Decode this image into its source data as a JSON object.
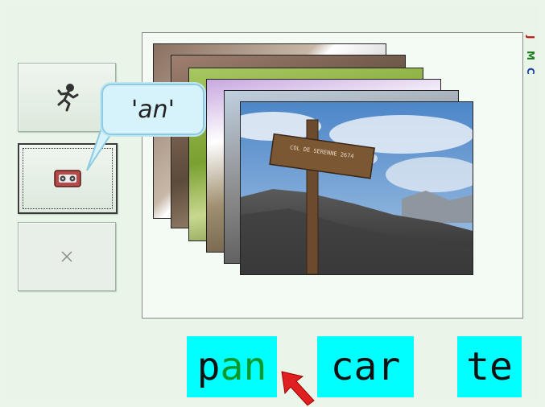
{
  "sidebar": {
    "buttons": [
      {
        "name": "run",
        "icon": "running-person-icon"
      },
      {
        "name": "listen",
        "icon": "cassette-tape-icon"
      },
      {
        "name": "close",
        "icon": "close-icon"
      }
    ]
  },
  "bubble": {
    "text": "'an'"
  },
  "word": {
    "syllables": [
      {
        "pre": "p",
        "highlight": "an",
        "post": ""
      },
      {
        "pre": "car",
        "highlight": "",
        "post": ""
      },
      {
        "pre": "te",
        "highlight": "",
        "post": ""
      }
    ]
  },
  "photo": {
    "sign_text": "COL DE SERENNE 2674"
  },
  "colors": {
    "syllable_bg": "#00ffff",
    "highlight_text": "#0a9a2a",
    "cursor": "#e02020"
  }
}
